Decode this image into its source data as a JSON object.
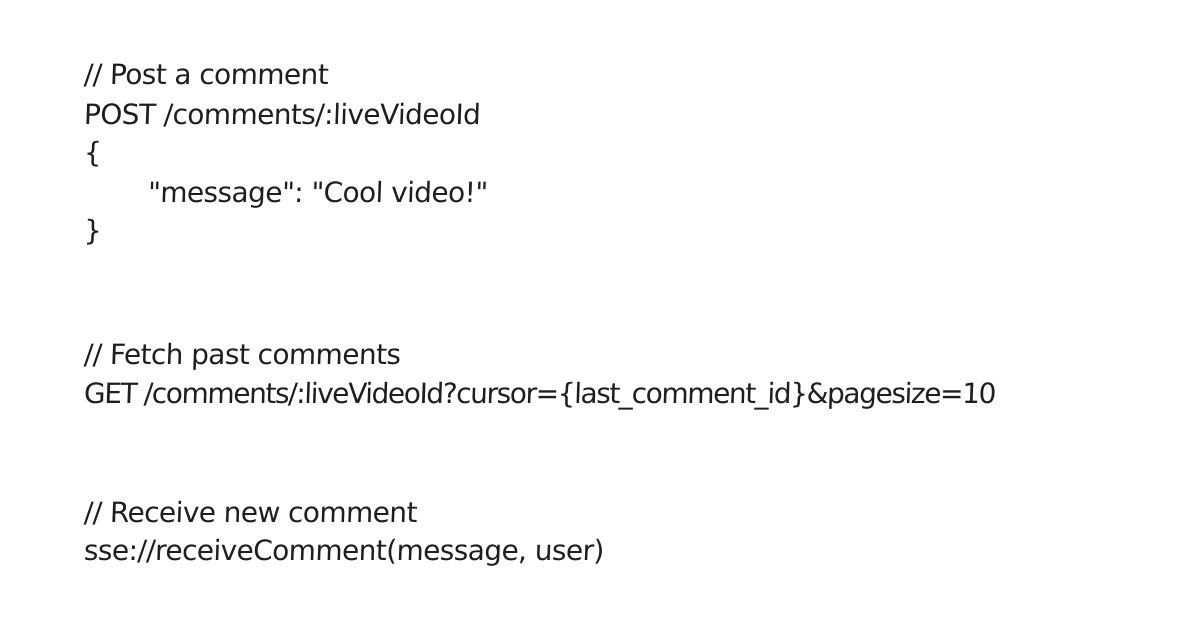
{
  "blocks": {
    "post_comment": {
      "comment": "// Post a comment",
      "request": "POST /comments/:liveVideoId",
      "open_brace": "{",
      "body_line": "\"message\": \"Cool video!\"",
      "close_brace": "}"
    },
    "fetch_comments": {
      "comment": "// Fetch past comments",
      "request": "GET /comments/:liveVideoId?cursor={last_comment_id}&pagesize=10"
    },
    "receive_comment": {
      "comment": "// Receive new comment",
      "request": "sse://receiveComment(message, user)"
    }
  }
}
